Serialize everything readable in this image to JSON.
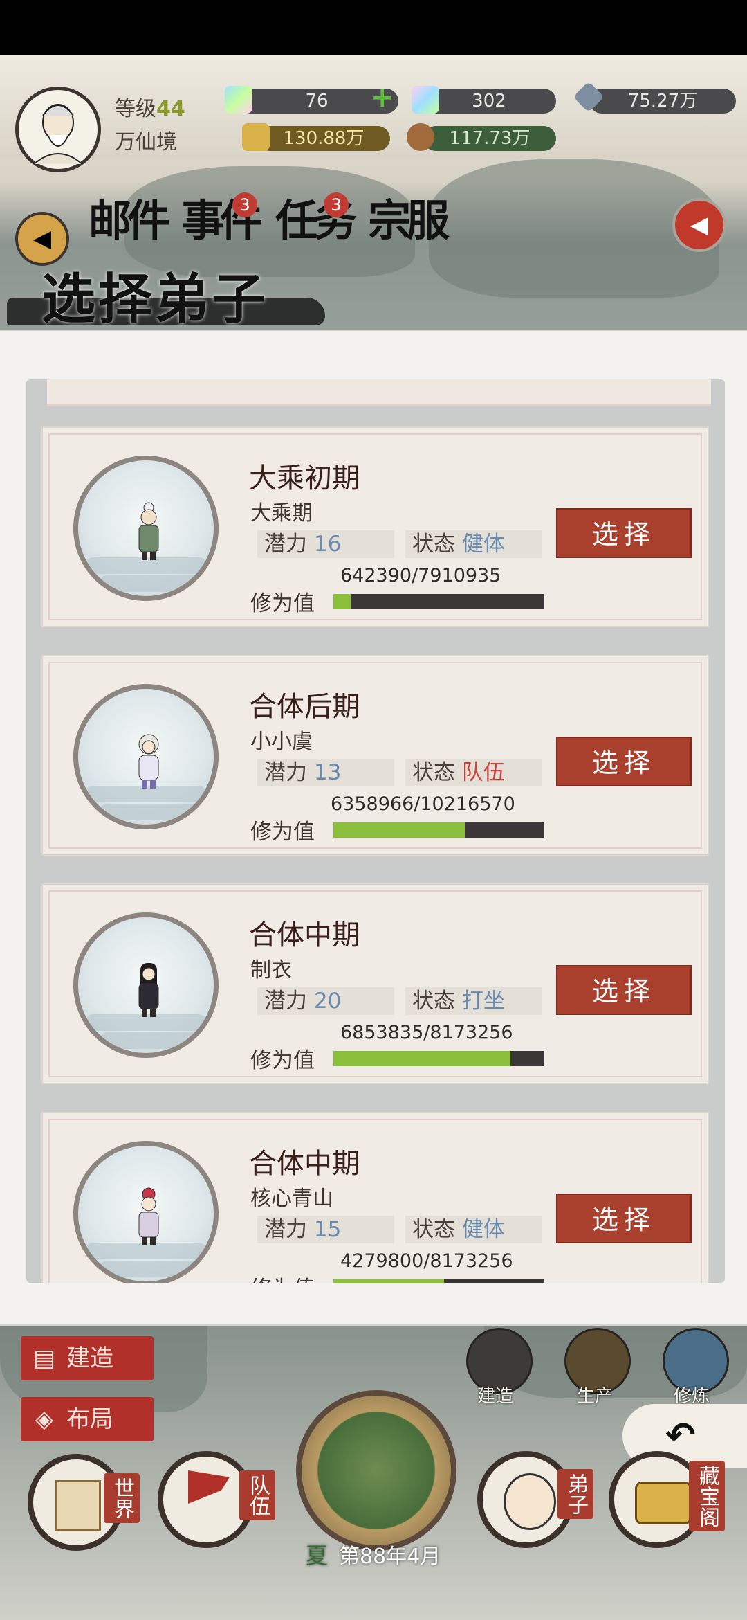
{
  "player": {
    "level_label": "等级",
    "level": "44",
    "realm": "万仙境"
  },
  "resources": {
    "spirit_stone": "76",
    "plus": "+",
    "jade": "302",
    "ore": "75.27万",
    "gold": "130.88万",
    "food": "117.73万"
  },
  "nav": {
    "back_arrow": "◀",
    "mail_label": "邮件",
    "events_label": "事件",
    "events_badge": "3",
    "tasks_label": "任务",
    "tasks_badge": "3",
    "sect_label": "宗服"
  },
  "page_title": "选择弟子",
  "disciples": [
    {
      "rank": "大乘初期",
      "name": "大乘期",
      "potential_label": "潜力",
      "potential": "16",
      "status_label": "状态",
      "status": "健体",
      "status_color": "#6a8bb0",
      "cultivation_label": "修为值",
      "cultivation": "642390/7910935",
      "progress": 0.081,
      "select_label": "选择"
    },
    {
      "rank": "合体后期",
      "name": "小小虞",
      "potential_label": "潜力",
      "potential": "13",
      "status_label": "状态",
      "status": "队伍",
      "status_color": "#c8423a",
      "cultivation_label": "修为值",
      "cultivation": "6358966/10216570",
      "progress": 0.622,
      "select_label": "选择"
    },
    {
      "rank": "合体中期",
      "name": "制衣",
      "potential_label": "潜力",
      "potential": "20",
      "status_label": "状态",
      "status": "打坐",
      "status_color": "#6a8bb0",
      "cultivation_label": "修为值",
      "cultivation": "6853835/8173256",
      "progress": 0.839,
      "select_label": "选择"
    },
    {
      "rank": "合体中期",
      "name": "核心青山",
      "potential_label": "潜力",
      "potential": "15",
      "status_label": "状态",
      "status": "健体",
      "status_color": "#6a8bb0",
      "cultivation_label": "修为值",
      "cultivation": "4279800/8173256",
      "progress": 0.524,
      "select_label": "选择"
    }
  ],
  "bottom": {
    "build_btn": "建造",
    "layout_btn": "布局",
    "side_build": "建造",
    "side_produce": "生产",
    "side_cultivate": "修炼",
    "world": "世界",
    "team": "队伍",
    "disciples": "弟子",
    "treasury": "藏宝阁",
    "season": "夏",
    "date": "第88年4月",
    "back": "↶"
  }
}
